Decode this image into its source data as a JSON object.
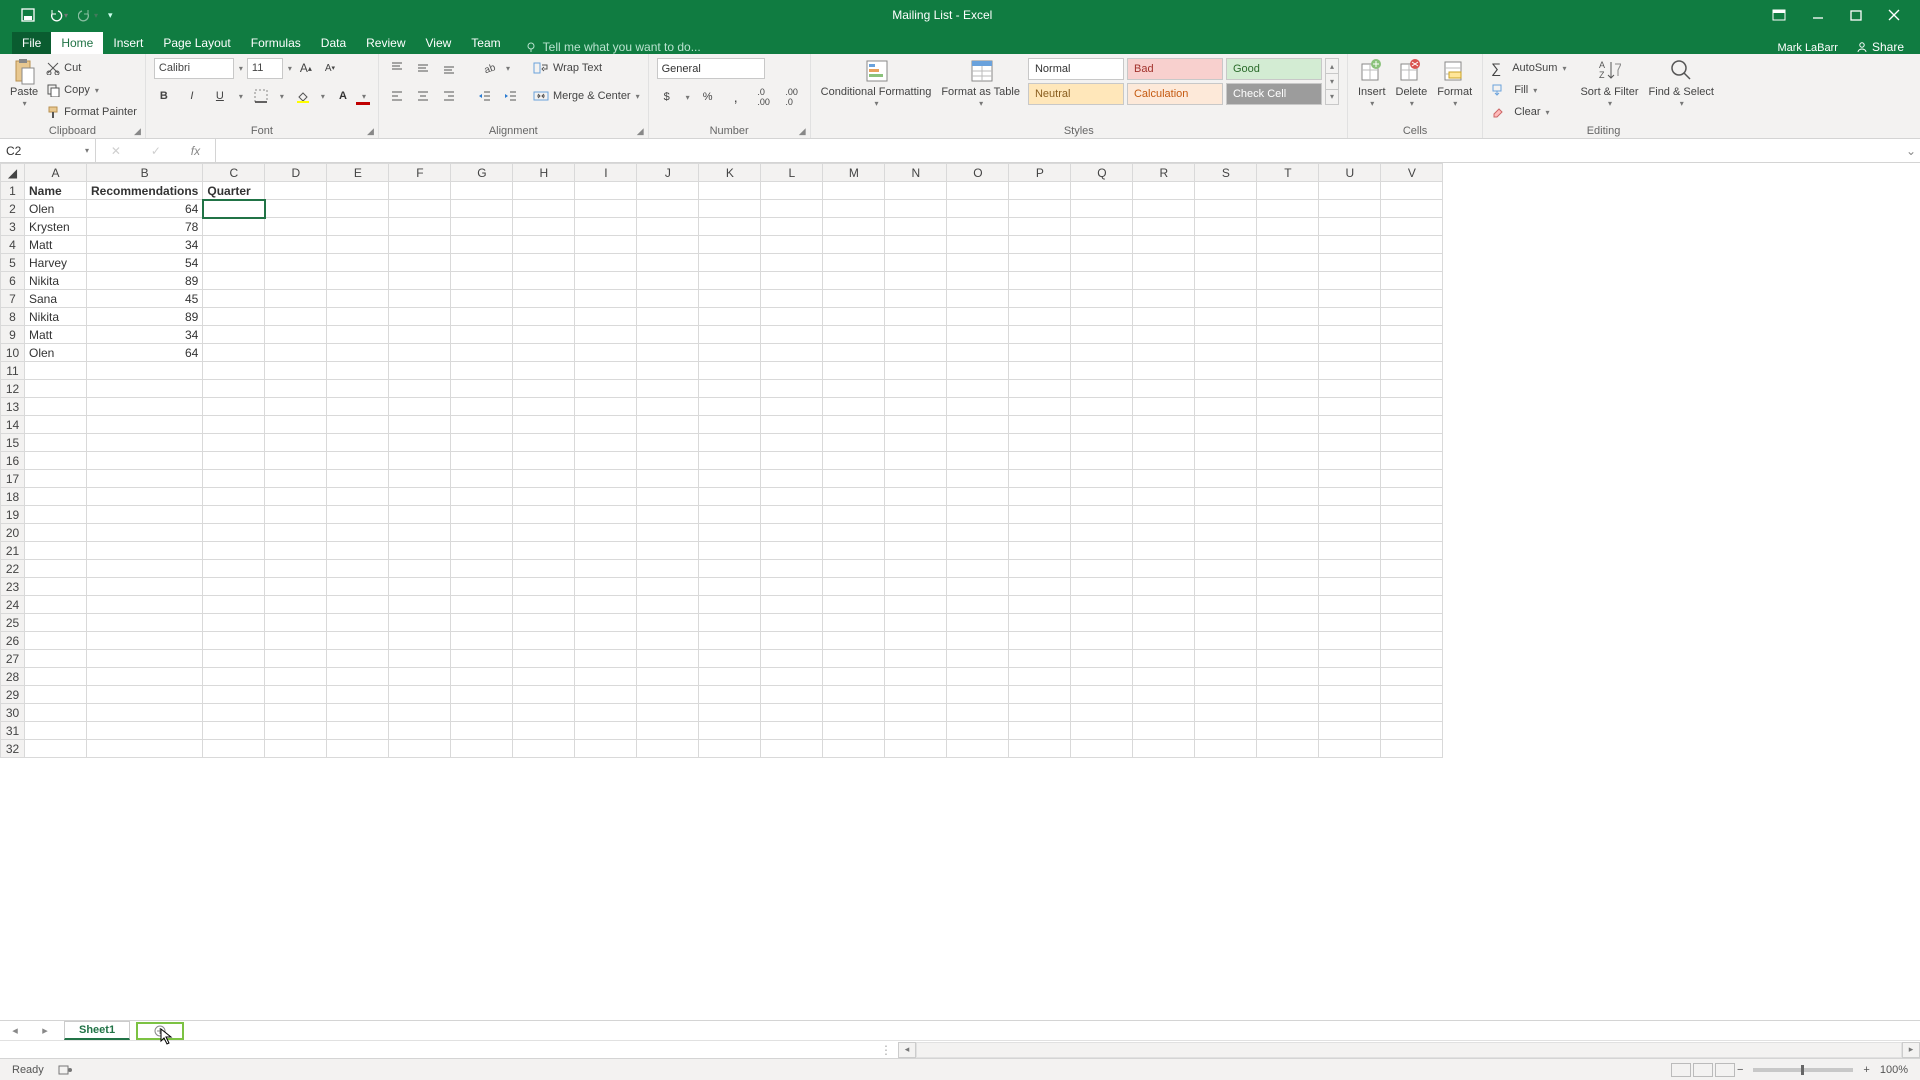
{
  "title": "Mailing List - Excel",
  "user": "Mark LaBarr",
  "share": "Share",
  "tabs": [
    "File",
    "Home",
    "Insert",
    "Page Layout",
    "Formulas",
    "Data",
    "Review",
    "View",
    "Team"
  ],
  "tellme": "Tell me what you want to do...",
  "ribbon": {
    "clipboard": {
      "paste": "Paste",
      "cut": "Cut",
      "copy": "Copy",
      "fp": "Format Painter",
      "label": "Clipboard"
    },
    "font": {
      "name": "Calibri",
      "size": "11",
      "label": "Font"
    },
    "alignment": {
      "wrap": "Wrap Text",
      "merge": "Merge & Center",
      "label": "Alignment"
    },
    "number": {
      "format": "General",
      "label": "Number"
    },
    "styles": {
      "cond": "Conditional Formatting",
      "fat": "Format as Table",
      "s": [
        "Normal",
        "Bad",
        "Good",
        "Neutral",
        "Calculation",
        "Check Cell"
      ],
      "label": "Styles"
    },
    "cells": {
      "insert": "Insert",
      "delete": "Delete",
      "format": "Format",
      "label": "Cells"
    },
    "editing": {
      "sum": "AutoSum",
      "fill": "Fill",
      "clear": "Clear",
      "sort": "Sort & Filter",
      "find": "Find & Select",
      "label": "Editing"
    }
  },
  "namebox": "C2",
  "columns": [
    "A",
    "B",
    "C",
    "D",
    "E",
    "F",
    "G",
    "H",
    "I",
    "J",
    "K",
    "L",
    "M",
    "N",
    "O",
    "P",
    "Q",
    "R",
    "S",
    "T",
    "U",
    "V"
  ],
  "headers": {
    "A": "Name",
    "B": "Recommendations",
    "C": "Quarter"
  },
  "rows": [
    {
      "n": "Olen",
      "r": 64
    },
    {
      "n": "Krysten",
      "r": 78
    },
    {
      "n": "Matt",
      "r": 34
    },
    {
      "n": "Harvey",
      "r": 54
    },
    {
      "n": "Nikita",
      "r": 89
    },
    {
      "n": "Sana",
      "r": 45
    },
    {
      "n": "Nikita",
      "r": 89
    },
    {
      "n": "Matt",
      "r": 34
    },
    {
      "n": "Olen",
      "r": 64
    }
  ],
  "blankRows": 22,
  "sheet": "Sheet1",
  "status": "Ready",
  "zoom": "100%"
}
